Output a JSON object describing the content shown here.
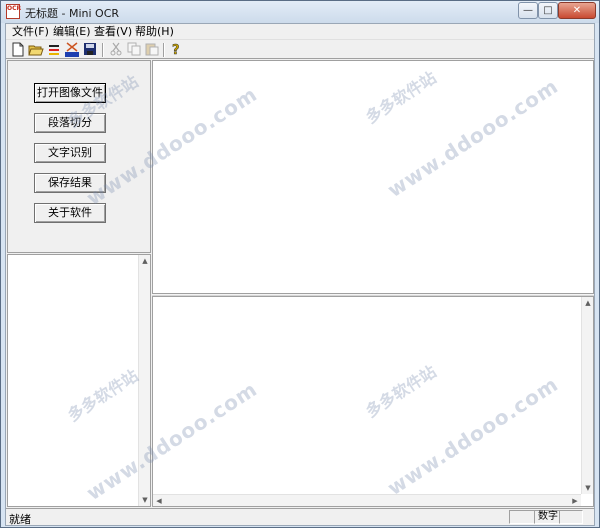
{
  "window": {
    "title": "无标题 - Mini OCR",
    "app_icon_text": "OCR",
    "controls": {
      "minimize": "—",
      "maximize": "□",
      "close": "✕"
    }
  },
  "menu": {
    "items": [
      {
        "label": "文件(F)"
      },
      {
        "label": "编辑(E)"
      },
      {
        "label": "查看(V)"
      },
      {
        "label": "帮助(H)"
      }
    ]
  },
  "toolbar": {
    "buttons": [
      {
        "icon": "new-file-icon"
      },
      {
        "icon": "open-folder-icon"
      },
      {
        "icon": "segment-icon"
      },
      {
        "icon": "ocr-icon"
      },
      {
        "icon": "save-icon"
      },
      {
        "icon": "cut-icon",
        "disabled": true
      },
      {
        "icon": "copy-icon",
        "disabled": true
      },
      {
        "icon": "paste-icon",
        "disabled": true
      },
      {
        "icon": "help-icon"
      }
    ]
  },
  "actions": {
    "open_image": "打开图像文件",
    "segment": "段落切分",
    "recognize": "文字识别",
    "save_result": "保存结果",
    "about": "关于软件"
  },
  "status": {
    "text": "就绪",
    "panel_num": "数字"
  },
  "watermarks": {
    "cn": "多多软件站",
    "url": "www.ddooo.com"
  }
}
